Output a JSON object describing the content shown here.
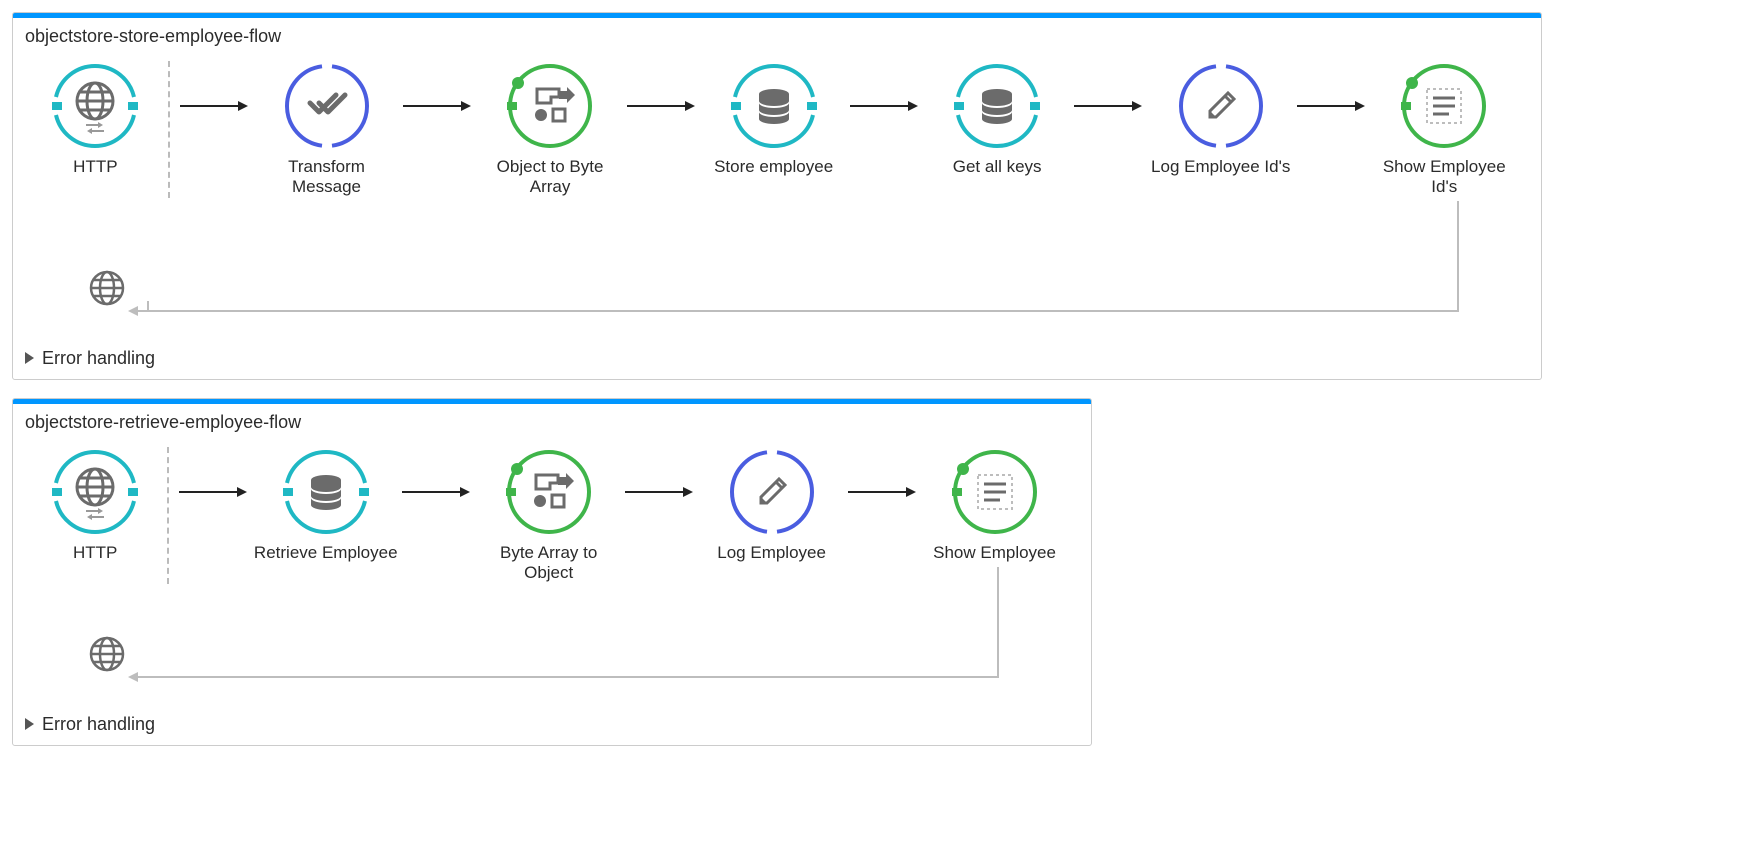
{
  "flows": [
    {
      "title": "objectstore-store-employee-flow",
      "errorLabel": "Error handling",
      "nodes": [
        {
          "label": "HTTP",
          "icon": "http",
          "ring": "teal-notch"
        },
        {
          "label": "Transform Message",
          "icon": "transform",
          "ring": "indigo-notch"
        },
        {
          "label": "Object to Byte Array",
          "icon": "convert",
          "ring": "green-dot"
        },
        {
          "label": "Store employee",
          "icon": "db",
          "ring": "teal-notch"
        },
        {
          "label": "Get all keys",
          "icon": "db",
          "ring": "teal-notch"
        },
        {
          "label": "Log Employee Id's",
          "icon": "pencil",
          "ring": "indigo-notch"
        },
        {
          "label": "Show Employee Id's",
          "icon": "payload",
          "ring": "green-dot"
        }
      ]
    },
    {
      "title": "objectstore-retrieve-employee-flow",
      "errorLabel": "Error handling",
      "nodes": [
        {
          "label": "HTTP",
          "icon": "http",
          "ring": "teal-notch"
        },
        {
          "label": "Retrieve Employee",
          "icon": "db",
          "ring": "teal-notch"
        },
        {
          "label": "Byte Array to Object",
          "icon": "convert",
          "ring": "green-dot"
        },
        {
          "label": "Log Employee",
          "icon": "pencil",
          "ring": "indigo-notch"
        },
        {
          "label": "Show Employee",
          "icon": "payload",
          "ring": "green-dot"
        }
      ]
    }
  ],
  "colors": {
    "teal": "#1fb8c4",
    "indigo": "#4a5de0",
    "green": "#3fb54a",
    "iconGray": "#6b6b6b",
    "lineGray": "#bdbdbd"
  }
}
